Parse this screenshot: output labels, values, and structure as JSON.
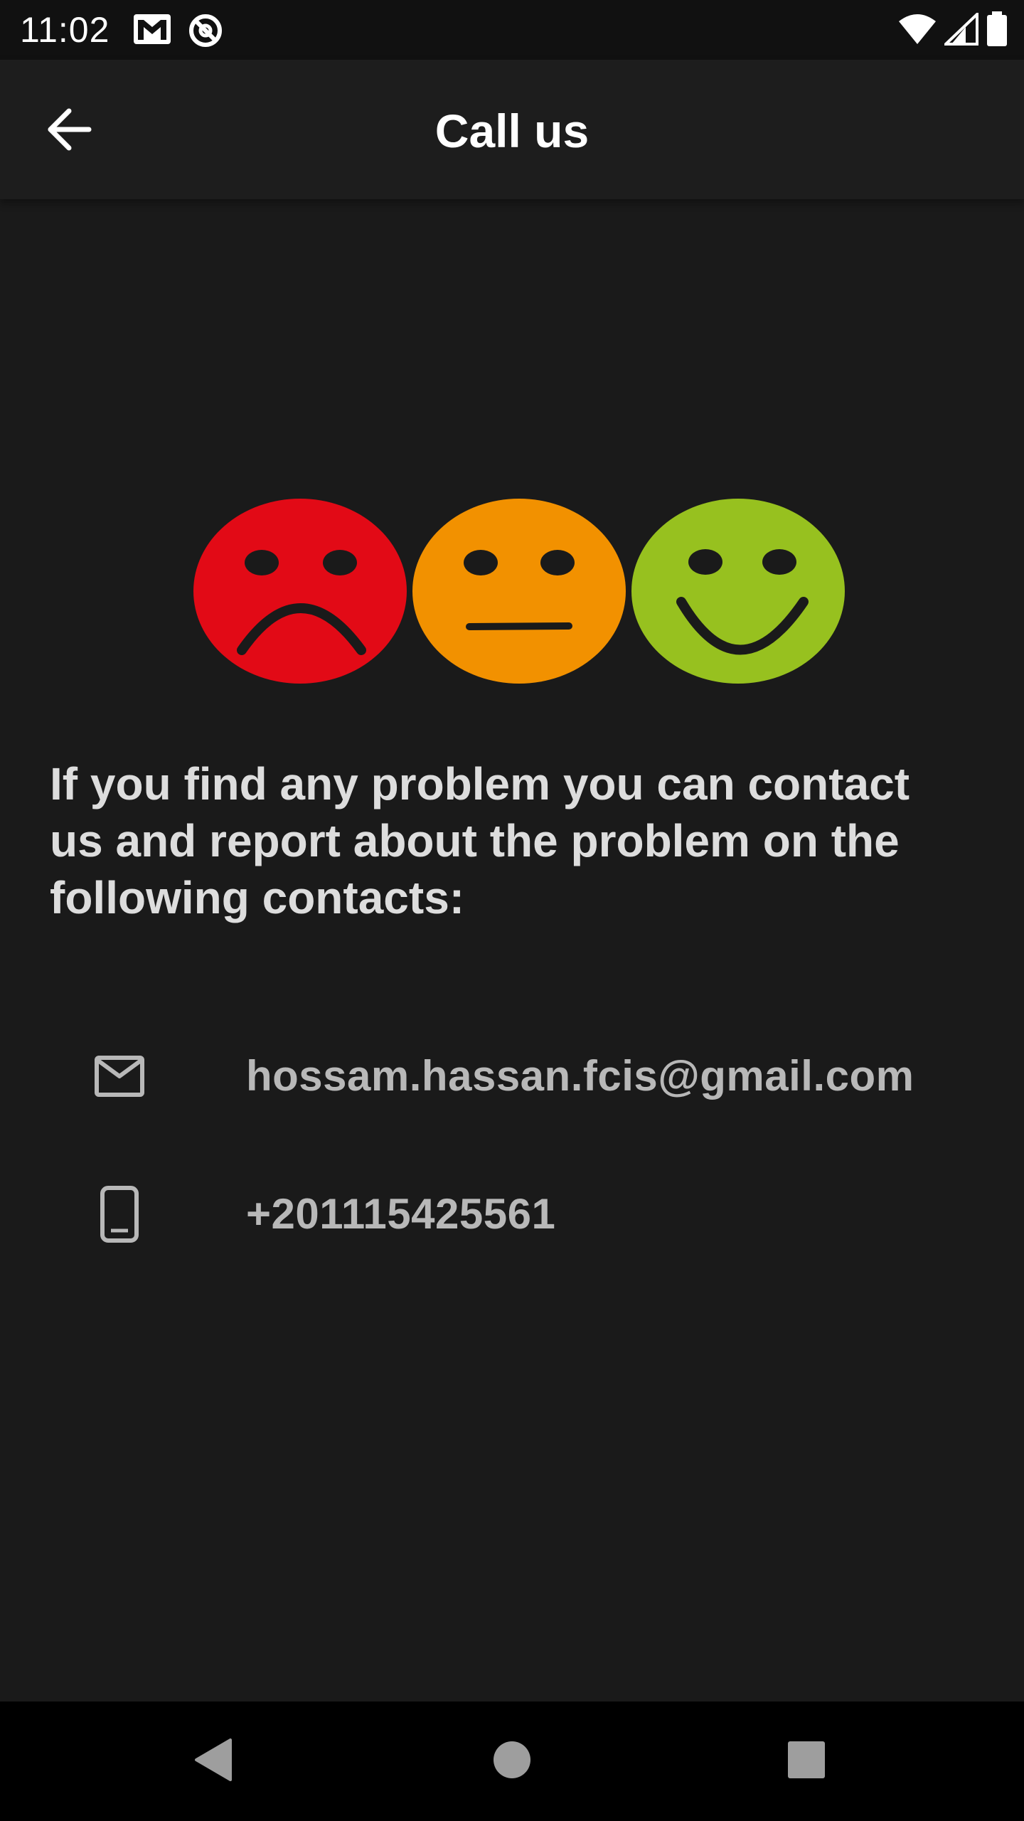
{
  "status_bar": {
    "time": "11:02",
    "left_icons": [
      "gmail-icon",
      "no-disturb-icon"
    ],
    "right_icons": [
      "wifi-icon",
      "signal-icon",
      "battery-icon"
    ]
  },
  "app_bar": {
    "title": "Call us",
    "back_icon": "arrow-back-icon"
  },
  "illustration": {
    "faces": [
      {
        "mood": "sad",
        "color": "#e20a16"
      },
      {
        "mood": "neutral",
        "color": "#f29100"
      },
      {
        "mood": "happy",
        "color": "#97c11f"
      }
    ]
  },
  "message": "If you find any problem you can contact us and report about the problem on the following contacts:",
  "contacts": [
    {
      "icon": "mail-icon",
      "value": "hossam.hassan.fcis@gmail.com"
    },
    {
      "icon": "phone-icon",
      "value": "+201115425561"
    }
  ],
  "nav_bar": {
    "buttons": [
      "back-triangle-icon",
      "home-circle-icon",
      "recents-square-icon"
    ]
  }
}
